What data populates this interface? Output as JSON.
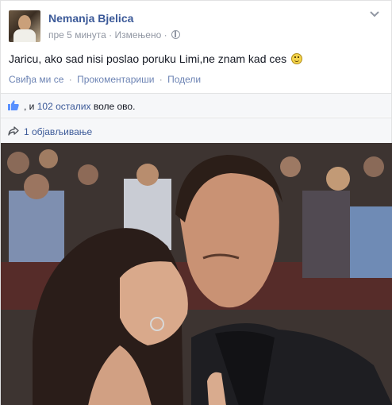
{
  "post": {
    "author": "Nemanja Bjelica",
    "time": "пре 5 минута",
    "meta_sep": "·",
    "edited": "Измењено",
    "text": "Jaricu, ako sad nisi poslao poruku Limi,ne znam kad ces",
    "actions": {
      "like": "Свиђа ми се",
      "comment": "Прокоментариши",
      "share": "Подели",
      "sep": "·"
    },
    "likes": {
      "prefix": ", и ",
      "others": "102 осталих",
      "suffix": " воле ово."
    },
    "shares": "1 објављивање",
    "icons": {
      "avatar": "avatar",
      "globe": "globe-icon",
      "chevron": "chevron-down-icon",
      "smiley": "smiley-icon",
      "like": "like-icon",
      "share": "share-icon"
    },
    "colors": {
      "link": "#3b5998",
      "muted": "#9197a3",
      "bar_bg": "#f6f7f9"
    }
  }
}
